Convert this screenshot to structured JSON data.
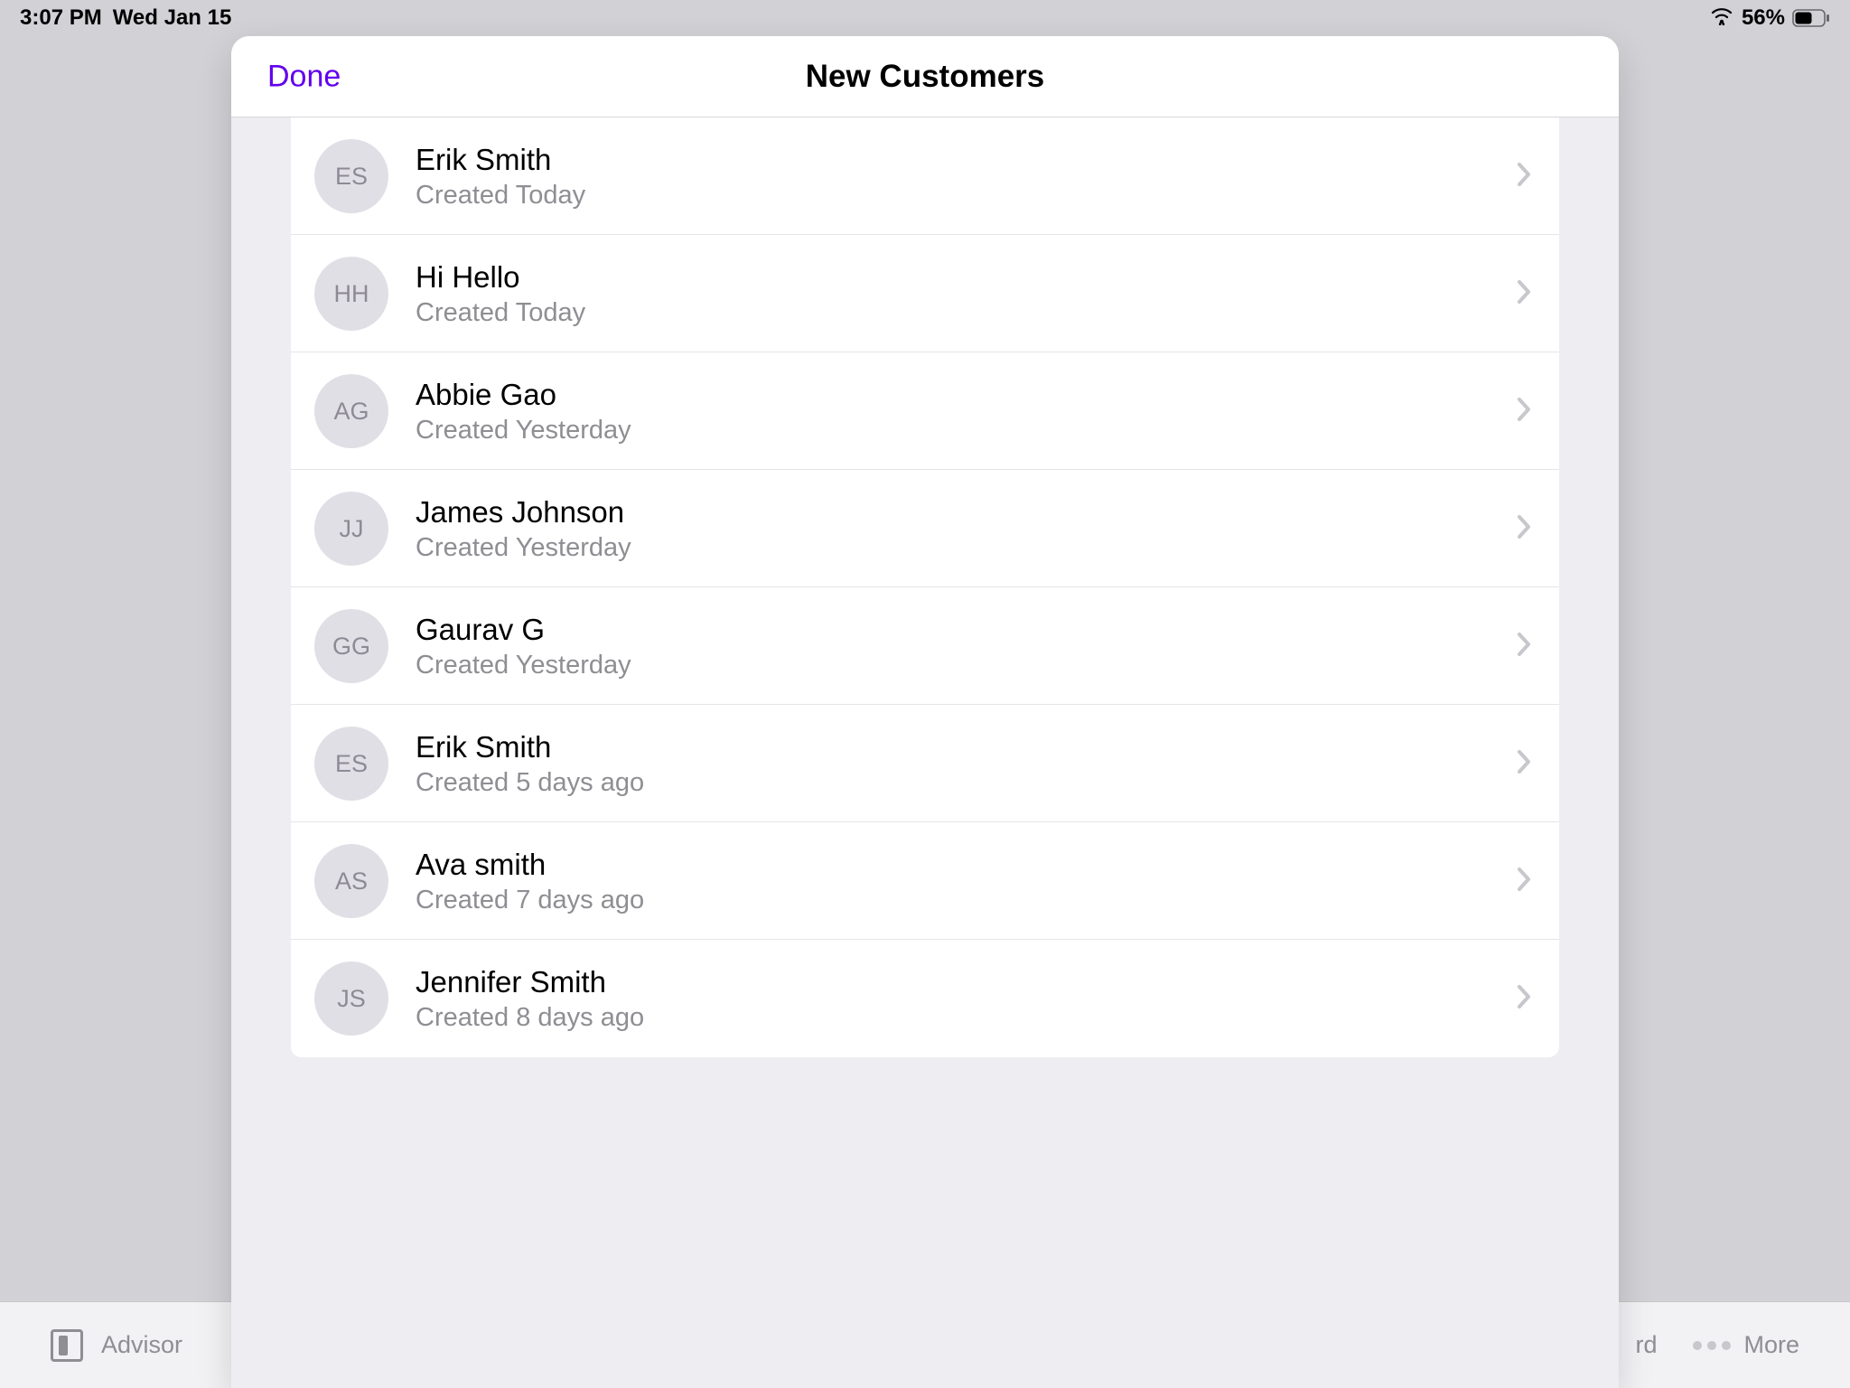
{
  "statusBar": {
    "time": "3:07 PM",
    "date": "Wed Jan 15",
    "batteryPercent": "56%"
  },
  "modal": {
    "doneLabel": "Done",
    "title": "New Customers"
  },
  "customers": [
    {
      "initials": "ES",
      "name": "Erik Smith",
      "created": "Created Today"
    },
    {
      "initials": "HH",
      "name": "Hi Hello",
      "created": "Created Today"
    },
    {
      "initials": "AG",
      "name": "Abbie Gao",
      "created": "Created Yesterday"
    },
    {
      "initials": "JJ",
      "name": "James Johnson",
      "created": "Created Yesterday"
    },
    {
      "initials": "GG",
      "name": "Gaurav G",
      "created": "Created Yesterday"
    },
    {
      "initials": "ES",
      "name": "Erik Smith",
      "created": "Created 5 days ago"
    },
    {
      "initials": "AS",
      "name": "Ava smith",
      "created": "Created 7 days ago"
    },
    {
      "initials": "JS",
      "name": "Jennifer Smith",
      "created": "Created 8 days ago"
    }
  ],
  "bottomBar": {
    "advisor": "Advisor",
    "rdSuffix": "rd",
    "more": "More"
  }
}
